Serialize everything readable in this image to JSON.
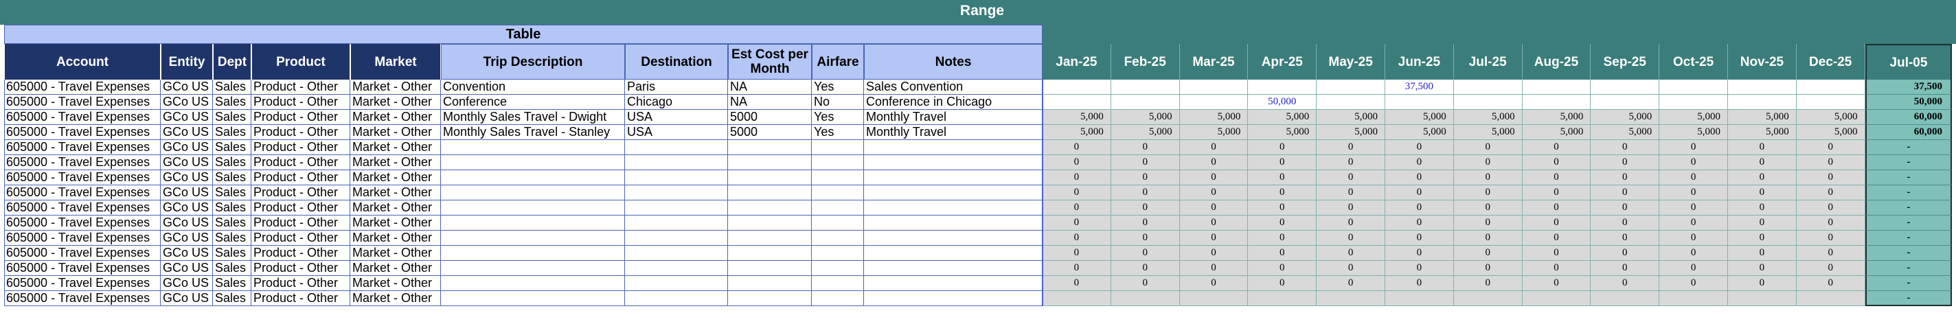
{
  "range_title": "Range",
  "table_title": "Table",
  "headers": {
    "account": "Account",
    "entity": "Entity",
    "dept": "Dept",
    "product": "Product",
    "market": "Market",
    "trip": "Trip Description",
    "destination": "Destination",
    "est_cost": "Est Cost per Month",
    "airfare": "Airfare",
    "notes": "Notes"
  },
  "months": [
    "Jan-25",
    "Feb-25",
    "Mar-25",
    "Apr-25",
    "May-25",
    "Jun-25",
    "Jul-25",
    "Aug-25",
    "Sep-25",
    "Oct-25",
    "Nov-25",
    "Dec-25"
  ],
  "total_header": "Jul-05",
  "rows": [
    {
      "account": "605000 - Travel Expenses",
      "entity": "GCo US",
      "dept": "Sales",
      "product": "Product - Other",
      "market": "Market - Other",
      "trip": "Convention",
      "destination": "Paris",
      "est_cost": "NA",
      "airfare": "Yes",
      "notes": "Sales Convention",
      "months": [
        "",
        "",
        "",
        "",
        "",
        "37,500",
        "",
        "",
        "",
        "",
        "",
        ""
      ],
      "total": "37,500",
      "style": "white"
    },
    {
      "account": "605000 - Travel Expenses",
      "entity": "GCo US",
      "dept": "Sales",
      "product": "Product - Other",
      "market": "Market - Other",
      "trip": "Conference",
      "destination": "Chicago",
      "est_cost": "NA",
      "airfare": "No",
      "notes": "Conference in Chicago",
      "months": [
        "",
        "",
        "",
        "50,000",
        "",
        "",
        "",
        "",
        "",
        "",
        "",
        ""
      ],
      "total": "50,000",
      "style": "white"
    },
    {
      "account": "605000 - Travel Expenses",
      "entity": "GCo US",
      "dept": "Sales",
      "product": "Product - Other",
      "market": "Market - Other",
      "trip": "Monthly Sales Travel - Dwight",
      "destination": "USA",
      "est_cost": "5000",
      "airfare": "Yes",
      "notes": "Monthly Travel",
      "months": [
        "5,000",
        "5,000",
        "5,000",
        "5,000",
        "5,000",
        "5,000",
        "5,000",
        "5,000",
        "5,000",
        "5,000",
        "5,000",
        "5,000"
      ],
      "total": "60,000",
      "style": "grey"
    },
    {
      "account": "605000 - Travel Expenses",
      "entity": "GCo US",
      "dept": "Sales",
      "product": "Product - Other",
      "market": "Market - Other",
      "trip": "Monthly Sales Travel - Stanley",
      "destination": "USA",
      "est_cost": "5000",
      "airfare": "Yes",
      "notes": "Monthly Travel",
      "months": [
        "5,000",
        "5,000",
        "5,000",
        "5,000",
        "5,000",
        "5,000",
        "5,000",
        "5,000",
        "5,000",
        "5,000",
        "5,000",
        "5,000"
      ],
      "total": "60,000",
      "style": "grey"
    },
    {
      "account": "605000 - Travel Expenses",
      "entity": "GCo US",
      "dept": "Sales",
      "product": "Product - Other",
      "market": "Market - Other",
      "trip": "",
      "destination": "",
      "est_cost": "",
      "airfare": "",
      "notes": "",
      "months": [
        "0",
        "0",
        "0",
        "0",
        "0",
        "0",
        "0",
        "0",
        "0",
        "0",
        "0",
        "0"
      ],
      "total": "-",
      "style": "grey"
    },
    {
      "account": "605000 - Travel Expenses",
      "entity": "GCo US",
      "dept": "Sales",
      "product": "Product - Other",
      "market": "Market - Other",
      "trip": "",
      "destination": "",
      "est_cost": "",
      "airfare": "",
      "notes": "",
      "months": [
        "0",
        "0",
        "0",
        "0",
        "0",
        "0",
        "0",
        "0",
        "0",
        "0",
        "0",
        "0"
      ],
      "total": "-",
      "style": "grey"
    },
    {
      "account": "605000 - Travel Expenses",
      "entity": "GCo US",
      "dept": "Sales",
      "product": "Product - Other",
      "market": "Market - Other",
      "trip": "",
      "destination": "",
      "est_cost": "",
      "airfare": "",
      "notes": "",
      "months": [
        "0",
        "0",
        "0",
        "0",
        "0",
        "0",
        "0",
        "0",
        "0",
        "0",
        "0",
        "0"
      ],
      "total": "-",
      "style": "grey"
    },
    {
      "account": "605000 - Travel Expenses",
      "entity": "GCo US",
      "dept": "Sales",
      "product": "Product - Other",
      "market": "Market - Other",
      "trip": "",
      "destination": "",
      "est_cost": "",
      "airfare": "",
      "notes": "",
      "months": [
        "0",
        "0",
        "0",
        "0",
        "0",
        "0",
        "0",
        "0",
        "0",
        "0",
        "0",
        "0"
      ],
      "total": "-",
      "style": "grey"
    },
    {
      "account": "605000 - Travel Expenses",
      "entity": "GCo US",
      "dept": "Sales",
      "product": "Product - Other",
      "market": "Market - Other",
      "trip": "",
      "destination": "",
      "est_cost": "",
      "airfare": "",
      "notes": "",
      "months": [
        "0",
        "0",
        "0",
        "0",
        "0",
        "0",
        "0",
        "0",
        "0",
        "0",
        "0",
        "0"
      ],
      "total": "-",
      "style": "grey"
    },
    {
      "account": "605000 - Travel Expenses",
      "entity": "GCo US",
      "dept": "Sales",
      "product": "Product - Other",
      "market": "Market - Other",
      "trip": "",
      "destination": "",
      "est_cost": "",
      "airfare": "",
      "notes": "",
      "months": [
        "0",
        "0",
        "0",
        "0",
        "0",
        "0",
        "0",
        "0",
        "0",
        "0",
        "0",
        "0"
      ],
      "total": "-",
      "style": "grey"
    },
    {
      "account": "605000 - Travel Expenses",
      "entity": "GCo US",
      "dept": "Sales",
      "product": "Product - Other",
      "market": "Market - Other",
      "trip": "",
      "destination": "",
      "est_cost": "",
      "airfare": "",
      "notes": "",
      "months": [
        "0",
        "0",
        "0",
        "0",
        "0",
        "0",
        "0",
        "0",
        "0",
        "0",
        "0",
        "0"
      ],
      "total": "-",
      "style": "grey"
    },
    {
      "account": "605000 - Travel Expenses",
      "entity": "GCo US",
      "dept": "Sales",
      "product": "Product - Other",
      "market": "Market - Other",
      "trip": "",
      "destination": "",
      "est_cost": "",
      "airfare": "",
      "notes": "",
      "months": [
        "0",
        "0",
        "0",
        "0",
        "0",
        "0",
        "0",
        "0",
        "0",
        "0",
        "0",
        "0"
      ],
      "total": "-",
      "style": "grey"
    },
    {
      "account": "605000 - Travel Expenses",
      "entity": "GCo US",
      "dept": "Sales",
      "product": "Product - Other",
      "market": "Market - Other",
      "trip": "",
      "destination": "",
      "est_cost": "",
      "airfare": "",
      "notes": "",
      "months": [
        "0",
        "0",
        "0",
        "0",
        "0",
        "0",
        "0",
        "0",
        "0",
        "0",
        "0",
        "0"
      ],
      "total": "-",
      "style": "grey"
    },
    {
      "account": "605000 - Travel Expenses",
      "entity": "GCo US",
      "dept": "Sales",
      "product": "Product - Other",
      "market": "Market - Other",
      "trip": "",
      "destination": "",
      "est_cost": "",
      "airfare": "",
      "notes": "",
      "months": [
        "0",
        "0",
        "0",
        "0",
        "0",
        "0",
        "0",
        "0",
        "0",
        "0",
        "0",
        "0"
      ],
      "total": "-",
      "style": "grey"
    },
    {
      "account": "605000 - Travel Expenses",
      "entity": "GCo US",
      "dept": "Sales",
      "product": "Product - Other",
      "market": "Market - Other",
      "trip": "",
      "destination": "",
      "est_cost": "",
      "airfare": "",
      "notes": "",
      "months": [
        "",
        "",
        "",
        "",
        "",
        "",
        "",
        "",
        "",
        "",
        "",
        ""
      ],
      "total": "-",
      "style": "grey"
    }
  ]
}
